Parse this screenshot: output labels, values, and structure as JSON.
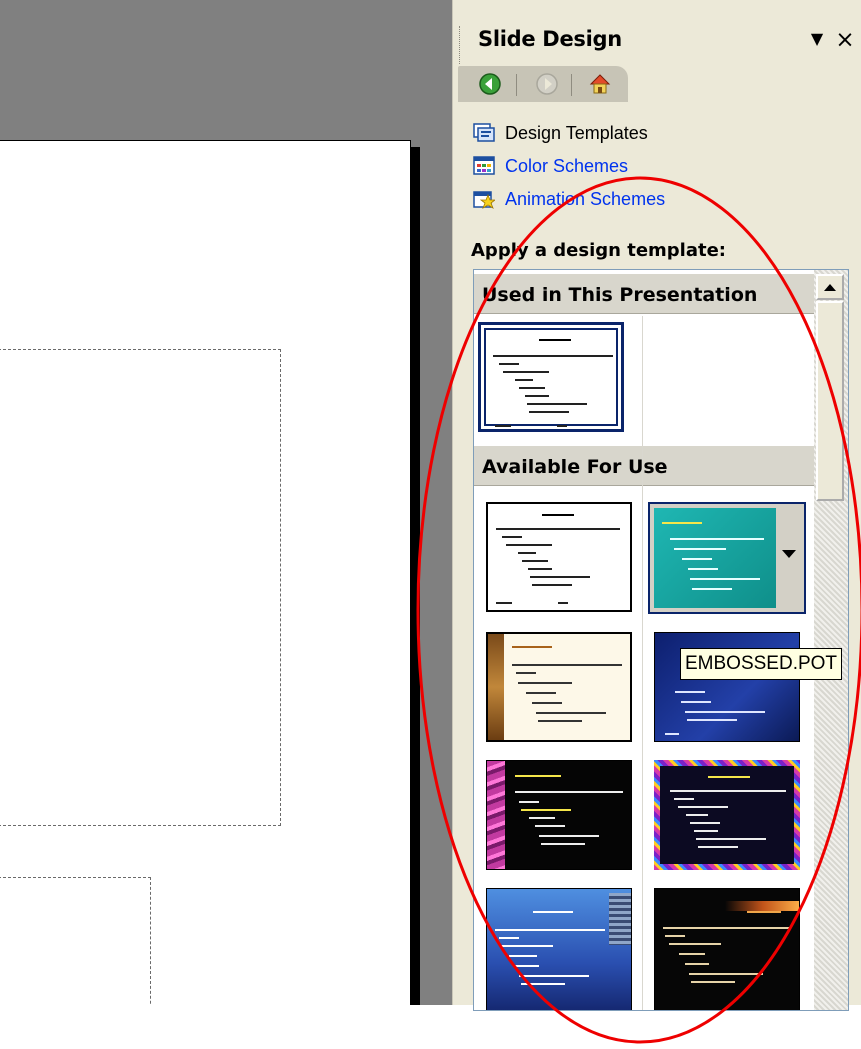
{
  "task_pane": {
    "title": "Slide Design",
    "close_glyph": "×",
    "menu_glyph": "▼",
    "links": [
      {
        "label": "Design Templates",
        "icon": "design-templates-icon"
      },
      {
        "label": "Color Schemes",
        "icon": "color-schemes-icon"
      },
      {
        "label": "Animation Schemes",
        "icon": "animation-schemes-icon"
      }
    ],
    "apply_heading": "Apply a design template:",
    "sections": {
      "used": "Used in This Presentation",
      "available": "Available For Use"
    },
    "tooltip": "EMBOSSED.POT"
  },
  "colors": {
    "annotation_ellipse": "#ee0000",
    "link": "#0033ee",
    "pane_background": "#ece9d8",
    "selection_border": "#0a246a"
  }
}
